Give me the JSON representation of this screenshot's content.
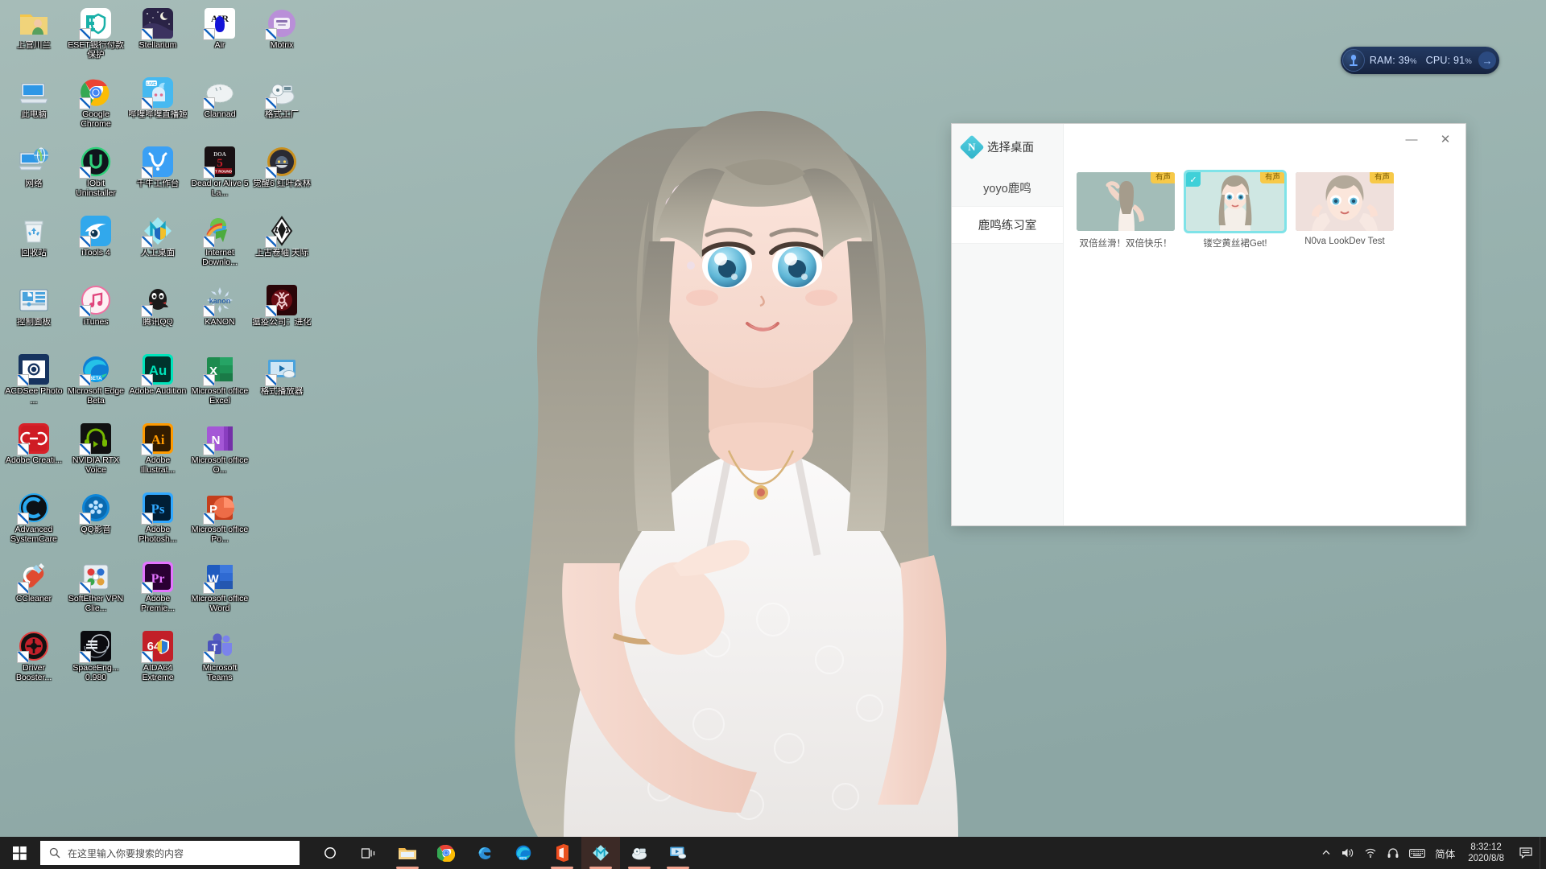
{
  "desktop": {
    "background_color": "#9ab3b0",
    "icons": [
      {
        "label": "上官川兰",
        "icon": "folder-user-icon",
        "kind": "folder",
        "shortcut": false
      },
      {
        "label": "ESET银行付款保护",
        "icon": "eset-banking-protection-icon",
        "kind": "eset",
        "shortcut": true
      },
      {
        "label": "Stellarium",
        "icon": "stellarium-icon",
        "kind": "stellarium",
        "shortcut": true
      },
      {
        "label": "Air",
        "icon": "air-game-icon",
        "kind": "air",
        "shortcut": true
      },
      {
        "label": "Motrix",
        "icon": "motrix-icon",
        "kind": "motrix",
        "shortcut": true
      },
      {
        "label": "此电脑",
        "icon": "this-pc-icon",
        "kind": "thispc",
        "shortcut": false
      },
      {
        "label": "Google Chrome",
        "icon": "google-chrome-icon",
        "kind": "chrome",
        "shortcut": true
      },
      {
        "label": "哔哩哔哩直播姬",
        "icon": "bilibili-live-icon",
        "kind": "bililive",
        "shortcut": true
      },
      {
        "label": "Clannad",
        "icon": "clannad-icon",
        "kind": "clannad",
        "shortcut": true
      },
      {
        "label": "格式工厂",
        "icon": "format-factory-icon",
        "kind": "formatfactory",
        "shortcut": true
      },
      {
        "label": "网络",
        "icon": "network-icon",
        "kind": "network",
        "shortcut": false
      },
      {
        "label": "IObit Uninstaller",
        "icon": "iobit-uninstaller-icon",
        "kind": "iobit",
        "shortcut": true
      },
      {
        "label": "千牛工作台",
        "icon": "qianniu-icon",
        "kind": "qianniu",
        "shortcut": true
      },
      {
        "label": "Dead or Alive 5 La...",
        "icon": "doa5-icon",
        "kind": "doa5",
        "shortcut": true
      },
      {
        "label": "觉醒6 红叶森林",
        "icon": "awaken6-icon",
        "kind": "awaken",
        "shortcut": true
      },
      {
        "label": "回收站",
        "icon": "recycle-bin-icon",
        "kind": "recycle",
        "shortcut": false
      },
      {
        "label": "iTools 4",
        "icon": "itools-icon",
        "kind": "itools",
        "shortcut": true
      },
      {
        "label": "人工桌面",
        "icon": "n0va-desktop-icon",
        "kind": "n0va",
        "shortcut": true
      },
      {
        "label": "Internet Downlo...",
        "icon": "idm-icon",
        "kind": "idm",
        "shortcut": true
      },
      {
        "label": "上古卷轴 天际",
        "icon": "skyrim-icon",
        "kind": "skyrim",
        "shortcut": true
      },
      {
        "label": "控制面板",
        "icon": "control-panel-icon",
        "kind": "controlpanel",
        "shortcut": false
      },
      {
        "label": "iTunes",
        "icon": "itunes-icon",
        "kind": "itunes",
        "shortcut": true
      },
      {
        "label": "腾讯QQ",
        "icon": "tencent-qq-icon",
        "kind": "qq",
        "shortcut": true
      },
      {
        "label": "KANON",
        "icon": "kanon-icon",
        "kind": "kanon",
        "shortcut": true
      },
      {
        "label": "瘟疫公司：进化",
        "icon": "plague-inc-icon",
        "kind": "plague",
        "shortcut": true
      },
      {
        "label": "ACDSee Photo ...",
        "icon": "acdsee-icon",
        "kind": "acdsee",
        "shortcut": true
      },
      {
        "label": "Microsoft Edge Beta",
        "icon": "edge-beta-icon",
        "kind": "edgebeta",
        "shortcut": true
      },
      {
        "label": "Adobe Audition",
        "icon": "adobe-audition-icon",
        "kind": "audition",
        "shortcut": true
      },
      {
        "label": "Microsoft office Excel",
        "icon": "excel-icon",
        "kind": "excel",
        "shortcut": true
      },
      {
        "label": "格式播放器",
        "icon": "format-player-icon",
        "kind": "formatplayer",
        "shortcut": true
      },
      {
        "label": "Adobe Creati...",
        "icon": "adobe-creative-cloud-icon",
        "kind": "cc",
        "shortcut": true
      },
      {
        "label": "NVIDIA RTX Voice",
        "icon": "nvidia-rtx-voice-icon",
        "kind": "rtxvoice",
        "shortcut": true
      },
      {
        "label": "Adobe Illustrat...",
        "icon": "adobe-illustrator-icon",
        "kind": "ai",
        "shortcut": true
      },
      {
        "label": "Microsoft office O...",
        "icon": "onenote-icon",
        "kind": "onenote",
        "shortcut": true
      },
      {
        "label": "",
        "icon": "",
        "kind": "empty",
        "shortcut": false
      },
      {
        "label": "Advanced SystemCare",
        "icon": "advanced-systemcare-icon",
        "kind": "asc",
        "shortcut": true
      },
      {
        "label": "QQ影音",
        "icon": "qq-player-icon",
        "kind": "qqplayer",
        "shortcut": true
      },
      {
        "label": "Adobe Photosh...",
        "icon": "adobe-photoshop-icon",
        "kind": "ps",
        "shortcut": true
      },
      {
        "label": "Microsoft office Po...",
        "icon": "powerpoint-icon",
        "kind": "ppt",
        "shortcut": true
      },
      {
        "label": "",
        "icon": "",
        "kind": "empty",
        "shortcut": false
      },
      {
        "label": "CCleaner",
        "icon": "ccleaner-icon",
        "kind": "ccleaner",
        "shortcut": true
      },
      {
        "label": "SoftEther VPN Clie...",
        "icon": "softether-vpn-icon",
        "kind": "softether",
        "shortcut": true
      },
      {
        "label": "Adobe Premie...",
        "icon": "adobe-premiere-icon",
        "kind": "pr",
        "shortcut": true
      },
      {
        "label": "Microsoft office Word",
        "icon": "word-icon",
        "kind": "word",
        "shortcut": true
      },
      {
        "label": "",
        "icon": "",
        "kind": "empty",
        "shortcut": false
      },
      {
        "label": "Driver Booster...",
        "icon": "driver-booster-icon",
        "kind": "driverbooster",
        "shortcut": true
      },
      {
        "label": "SpaceEng... 0.980",
        "icon": "space-engine-icon",
        "kind": "spaceengine",
        "shortcut": true
      },
      {
        "label": "AIDA64 Extreme",
        "icon": "aida64-icon",
        "kind": "aida64",
        "shortcut": true
      },
      {
        "label": "Microsoft Teams",
        "icon": "microsoft-teams-icon",
        "kind": "teams",
        "shortcut": true
      },
      {
        "label": "",
        "icon": "",
        "kind": "empty",
        "shortcut": false
      }
    ]
  },
  "perf_widget": {
    "ram_label": "RAM:",
    "ram_value": "39",
    "cpu_label": "CPU:",
    "cpu_value": "91",
    "unit": "%",
    "arrow": "→",
    "accent": "#2b4a80"
  },
  "dialog": {
    "brand_letter": "N",
    "title": "选择桌面",
    "minimize": "—",
    "close": "✕",
    "sidebar": [
      {
        "label": "yoyo鹿鸣",
        "active": false
      },
      {
        "label": "鹿鸣练习室",
        "active": true
      }
    ],
    "cards": [
      {
        "caption": "双倍丝滑！双倍快乐！",
        "tag": "有声",
        "selected": false,
        "art": "th-a"
      },
      {
        "caption": "镂空黄丝裙Get!",
        "tag": "有声",
        "selected": true,
        "art": "th-b",
        "check": "✓"
      },
      {
        "caption": "N0va LookDev Test",
        "tag": "有声",
        "selected": false,
        "art": "th-c"
      }
    ]
  },
  "taskbar": {
    "start_icon": "windows-start-icon",
    "search": {
      "placeholder": "在这里输入你要搜索的内容",
      "value": "",
      "icon": "search-icon"
    },
    "buttons": [
      {
        "name": "cortana-icon",
        "glyph": "◯",
        "active": false,
        "running": false
      },
      {
        "name": "task-view-icon",
        "glyph": "❏",
        "active": false,
        "running": false
      },
      {
        "name": "file-explorer-icon",
        "glyph": "",
        "active": false,
        "running": true
      },
      {
        "name": "google-chrome-icon",
        "glyph": "",
        "active": false,
        "running": false
      },
      {
        "name": "microsoft-edge-icon",
        "glyph": "",
        "active": false,
        "running": false
      },
      {
        "name": "edge-beta-icon",
        "glyph": "",
        "active": false,
        "running": false
      },
      {
        "name": "microsoft-office-icon",
        "glyph": "",
        "active": false,
        "running": true
      },
      {
        "name": "n0va-desktop-icon",
        "glyph": "",
        "active": true,
        "running": true
      },
      {
        "name": "format-factory-icon",
        "glyph": "",
        "active": false,
        "running": true
      },
      {
        "name": "format-player-icon",
        "glyph": "",
        "active": false,
        "running": true
      }
    ],
    "tray": [
      {
        "name": "show-hidden-icons-chevron",
        "glyph": "⌃"
      },
      {
        "name": "volume-icon",
        "glyph": "🔊"
      },
      {
        "name": "wifi-icon",
        "glyph": "📶"
      },
      {
        "name": "headset-icon",
        "glyph": "🎧"
      },
      {
        "name": "keyboard-icon",
        "glyph": "⌨"
      },
      {
        "name": "ime-mode-label",
        "glyph": "简体"
      }
    ],
    "clock": {
      "time": "8:32:12",
      "date": "2020/8/8"
    },
    "notifications_icon": "action-center-icon"
  }
}
